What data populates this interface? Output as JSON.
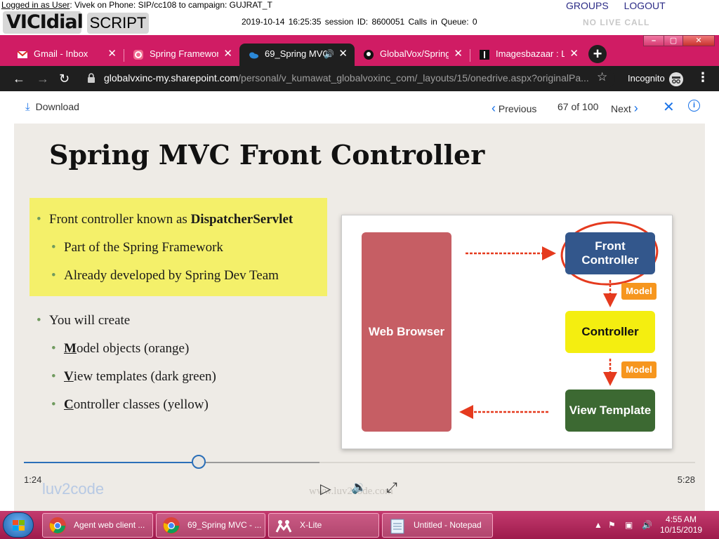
{
  "vicidial": {
    "login_prefix": "Logged in as User",
    "login_rest": ": Vivek on Phone: SIP/cc108  to campaign: GUJRAT_T",
    "logo_text": "VICIdial",
    "script_tab": "SCRIPT",
    "status_line": "2019-10-14 16:25:35   session ID: 8600051   Calls in Queue: 0",
    "groups_link": "GROUPS",
    "logout_link": "LOGOUT",
    "no_live_call": "NO LIVE CALL"
  },
  "browser": {
    "accent_color": "#d01c64",
    "tabs": [
      {
        "title": "Gmail - Inbox",
        "icon": "gmail-icon"
      },
      {
        "title": "Spring Framework",
        "icon": "spring-icon"
      },
      {
        "title": "69_Spring MVC",
        "icon": "onedrive-icon"
      },
      {
        "title": "GlobalVox/SpringB",
        "icon": "github-icon"
      },
      {
        "title": "Imagesbazaar : Lar",
        "icon": "imagesbazaar-icon"
      }
    ],
    "url_host": "globalvxinc-my.sharepoint.com",
    "url_path": "/personal/v_kumawat_globalvoxinc_com/_layouts/15/onedrive.aspx?originalPa...",
    "incognito_label": "Incognito"
  },
  "viewer": {
    "download_label": "Download",
    "previous_label": "Previous",
    "page_counter": "67 of 100",
    "next_label": "Next"
  },
  "slide": {
    "title": "Spring MVC Front Controller",
    "bullet1_prefix": "Front controller known as ",
    "bullet1_bold": "DispatcherServlet",
    "sub1": "Part of the Spring Framework",
    "sub2": "Already developed by Spring Dev Team",
    "bullet2": "You will create",
    "model_first": "M",
    "model_rest": "odel objects (orange)",
    "view_first": "V",
    "view_rest": "iew templates (dark green)",
    "ctrl_first": "C",
    "ctrl_rest": "ontroller classes (yellow)",
    "diagram": {
      "web_browser": "Web Browser",
      "front_controller": "Front Controller",
      "controller": "Controller",
      "view_template": "View Template",
      "model_tag": "Model"
    }
  },
  "player": {
    "current_time": "1:24",
    "total_time": "5:28",
    "played_fraction": 0.26,
    "buffered_fraction": 0.44,
    "brand": "luv2code",
    "watermark": "www.luv2code.com"
  },
  "taskbar": {
    "items": [
      {
        "label": "Agent web client ...",
        "icon": "chrome-icon"
      },
      {
        "label": "69_Spring MVC - ...",
        "icon": "chrome-icon"
      },
      {
        "label": "X-Lite",
        "icon": "xlite-icon"
      },
      {
        "label": "Untitled - Notepad",
        "icon": "notepad-icon"
      }
    ],
    "time": "4:55 AM",
    "date": "10/15/2019"
  }
}
